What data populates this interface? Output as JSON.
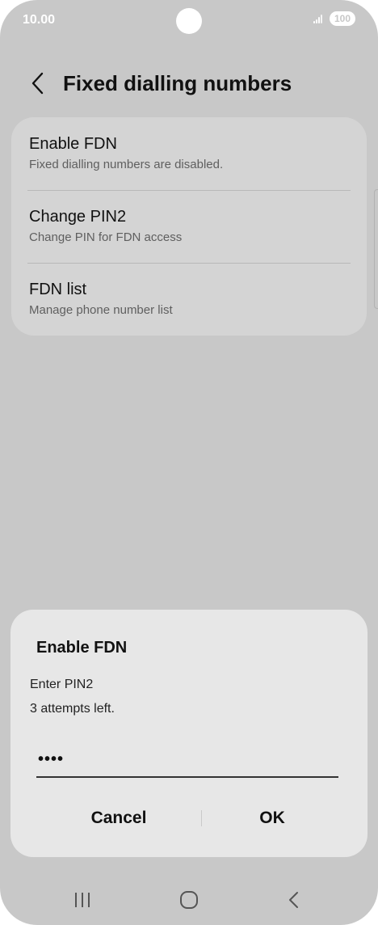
{
  "status_bar": {
    "time": "10.00",
    "battery": "100"
  },
  "header": {
    "title": "Fixed dialling numbers"
  },
  "settings": [
    {
      "title": "Enable FDN",
      "subtitle": "Fixed dialling numbers are disabled."
    },
    {
      "title": "Change PIN2",
      "subtitle": "Change PIN for FDN access"
    },
    {
      "title": "FDN list",
      "subtitle": "Manage phone number list"
    }
  ],
  "dialog": {
    "title": "Enable FDN",
    "prompt": "Enter PIN2",
    "attempts": "3 attempts left.",
    "pin_value": "••••",
    "cancel_label": "Cancel",
    "ok_label": "OK"
  },
  "nav_bar": {
    "items": [
      "recent-apps-icon",
      "home-icon",
      "back-icon"
    ]
  },
  "colors": {
    "background": "#c8c8c8",
    "card": "#d4d4d4",
    "dialog": "#e7e7e7",
    "text": "#111111"
  }
}
